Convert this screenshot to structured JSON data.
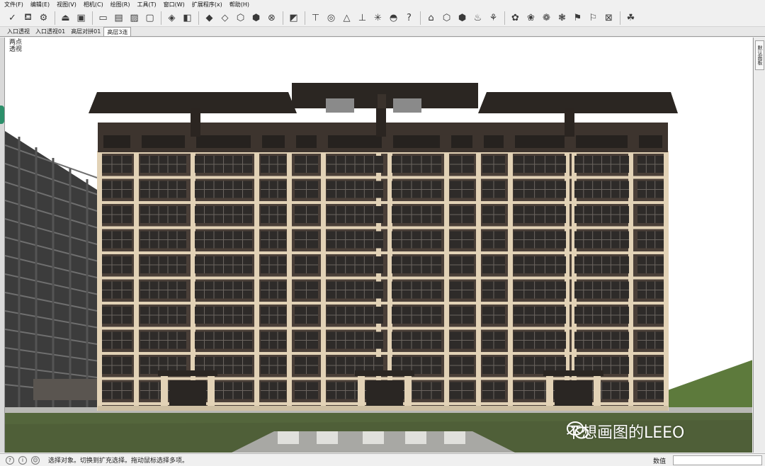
{
  "menu": {
    "items": [
      {
        "label": "文件(F)"
      },
      {
        "label": "编辑(E)"
      },
      {
        "label": "视图(V)"
      },
      {
        "label": "相机(C)"
      },
      {
        "label": "绘图(R)"
      },
      {
        "label": "工具(T)"
      },
      {
        "label": "窗口(W)"
      },
      {
        "label": "扩展程序(x)"
      },
      {
        "label": "帮助(H)"
      }
    ]
  },
  "toolbar": {
    "groups": [
      {
        "buttons": [
          {
            "icon": "select-arrow-icon",
            "glyph": "✓"
          },
          {
            "icon": "paint-bucket-icon",
            "glyph": "⛾"
          },
          {
            "icon": "component-icon",
            "glyph": "⚙"
          }
        ]
      },
      {
        "buttons": [
          {
            "icon": "warehouse-icon",
            "glyph": "⏏"
          },
          {
            "icon": "upload-icon",
            "glyph": "▣"
          }
        ]
      },
      {
        "buttons": [
          {
            "icon": "scene-window-icon",
            "glyph": "▭"
          },
          {
            "icon": "save-scene-icon",
            "glyph": "▤"
          },
          {
            "icon": "photo-icon",
            "glyph": "▨"
          },
          {
            "icon": "lock-icon",
            "glyph": "▢"
          }
        ]
      },
      {
        "buttons": [
          {
            "icon": "layers-icon",
            "glyph": "◈"
          },
          {
            "icon": "group-icon",
            "glyph": "◧"
          }
        ]
      },
      {
        "buttons": [
          {
            "icon": "iso-view-icon",
            "glyph": "◆"
          },
          {
            "icon": "top-view-icon",
            "glyph": "◇"
          },
          {
            "icon": "front-view-icon",
            "glyph": "⬡"
          },
          {
            "icon": "right-view-icon",
            "glyph": "⬢"
          },
          {
            "icon": "x-ray-icon",
            "glyph": "⊗"
          }
        ]
      },
      {
        "buttons": [
          {
            "icon": "section-icon",
            "glyph": "◩"
          }
        ]
      },
      {
        "buttons": [
          {
            "icon": "tape-measure-icon",
            "glyph": "⊤"
          },
          {
            "icon": "circle-icon",
            "glyph": "◎"
          },
          {
            "icon": "protractor-icon",
            "glyph": "△"
          },
          {
            "icon": "axes-icon",
            "glyph": "⊥"
          },
          {
            "icon": "sun-icon",
            "glyph": "✳"
          },
          {
            "icon": "dimension-icon",
            "glyph": "◓"
          },
          {
            "icon": "help-icon",
            "glyph": "?"
          }
        ]
      },
      {
        "buttons": [
          {
            "icon": "walk-icon",
            "glyph": "⌂"
          },
          {
            "icon": "box-icon",
            "glyph": "⬡"
          },
          {
            "icon": "shaded-box-icon",
            "glyph": "⬢"
          },
          {
            "icon": "sandbox-icon",
            "glyph": "♨"
          },
          {
            "icon": "terrain-icon",
            "glyph": "⚘"
          }
        ]
      },
      {
        "buttons": [
          {
            "icon": "shadow-icon",
            "glyph": "✿"
          },
          {
            "icon": "fog-icon",
            "glyph": "❀"
          },
          {
            "icon": "style-icon",
            "glyph": "❁"
          },
          {
            "icon": "plugin-icon",
            "glyph": "❃"
          },
          {
            "icon": "flag-icon",
            "glyph": "⚑"
          },
          {
            "icon": "flag2-icon",
            "glyph": "⚐"
          },
          {
            "icon": "close-model-icon",
            "glyph": "⊠"
          }
        ]
      },
      {
        "buttons": [
          {
            "icon": "leaf-icon",
            "glyph": "☘"
          }
        ]
      }
    ]
  },
  "tabs": [
    {
      "label": "入口透视",
      "active": false
    },
    {
      "label": "入口透视01",
      "active": false
    },
    {
      "label": "高层对拼01",
      "active": false
    },
    {
      "label": "高层3连",
      "active": true
    }
  ],
  "viewport": {
    "scene_label_line1": "两点",
    "scene_label_line2": "透视",
    "watermark": "不想画图的LEEO"
  },
  "right_tray": {
    "tab_label": "默认面板"
  },
  "status": {
    "text": "选择对象。切换到扩充选择。拖动鼠标选择多项。",
    "measure_label": "数值",
    "measure_value": ""
  },
  "colors": {
    "facade_dark": "#4a3f38",
    "facade_stone": "#e2d2b6",
    "roof": "#2b2622",
    "window": "#2e2b29",
    "grass": "#54663c",
    "paving": "#b9b9b5"
  }
}
